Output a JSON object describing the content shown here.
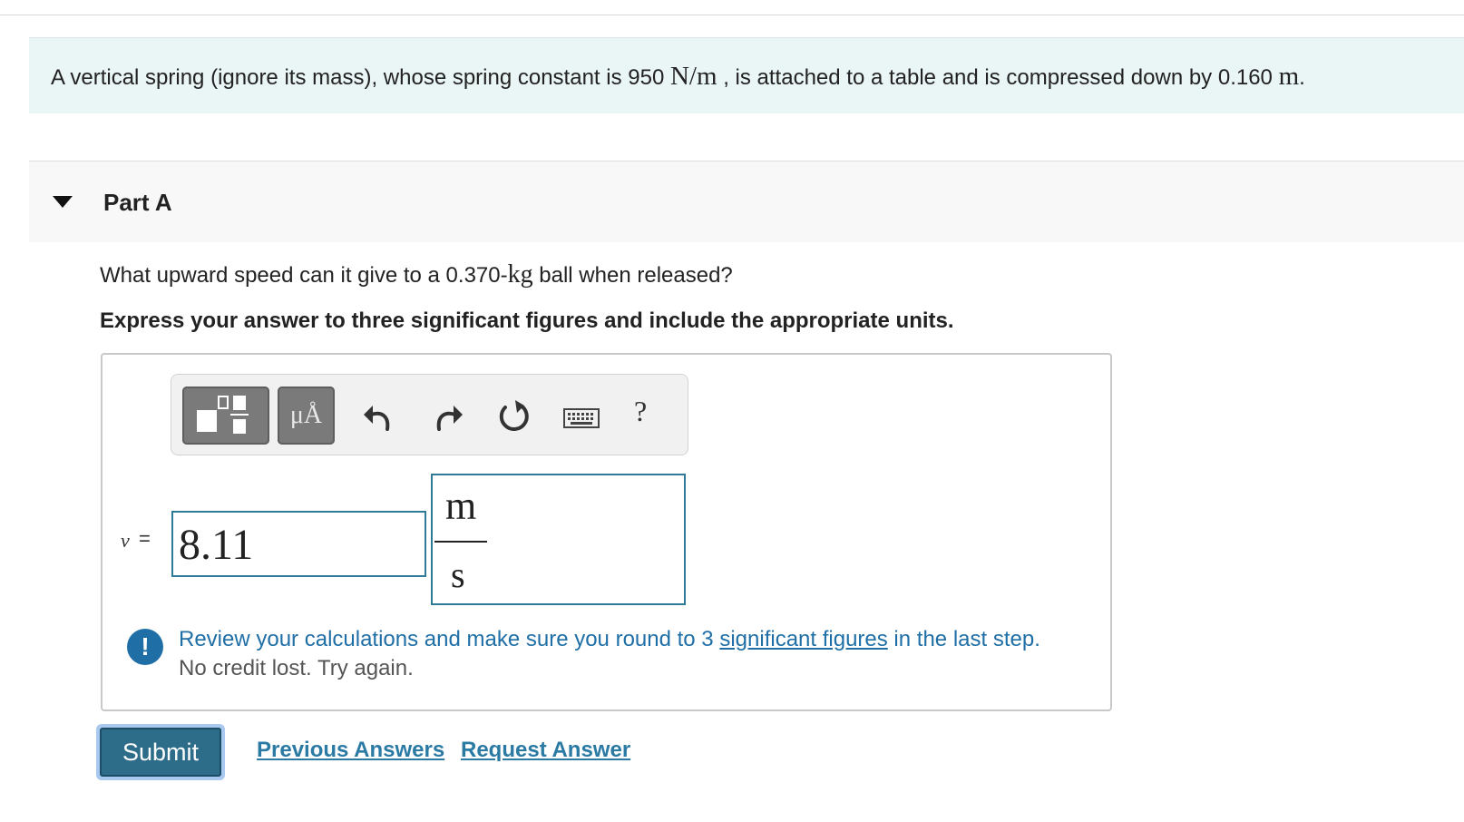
{
  "intro": {
    "text_before_k": "A vertical spring (ignore its mass), whose spring constant is 950 ",
    "k_unit": "N/m",
    "text_middle": " , is attached to a table and is compressed down by 0.160 ",
    "x_unit": "m",
    "text_end": "."
  },
  "part": {
    "title": "Part A"
  },
  "question": {
    "text_before": "What upward speed can it give to a 0.370-",
    "mass_unit": "kg",
    "text_after": " ball when released?"
  },
  "instruction": "Express your answer to three significant figures and include the appropriate units.",
  "toolbar": {
    "units_label": "μÅ",
    "help_label": "?",
    "icons": [
      "templates-icon",
      "units-icon",
      "undo-icon",
      "redo-icon",
      "reset-icon",
      "keyboard-icon",
      "help-icon"
    ]
  },
  "answer": {
    "variable": "v",
    "equals": "=",
    "value": "8.11",
    "unit_numerator": "m",
    "unit_denominator": "s"
  },
  "feedback": {
    "icon_symbol": "!",
    "line1_before": "Review your calculations and make sure you round to 3 ",
    "line1_link": "significant figures",
    "line1_after": " in the last step.",
    "line2": "No credit lost. Try again."
  },
  "actions": {
    "submit_label": "Submit",
    "previous_answers_label": "Previous Answers",
    "request_answer_label": "Request Answer"
  },
  "colors": {
    "intro_bg": "#eaf5f6",
    "accent_blue": "#1f6fa6",
    "input_border": "#2f7a96",
    "submit_bg": "#2e6d8a"
  }
}
